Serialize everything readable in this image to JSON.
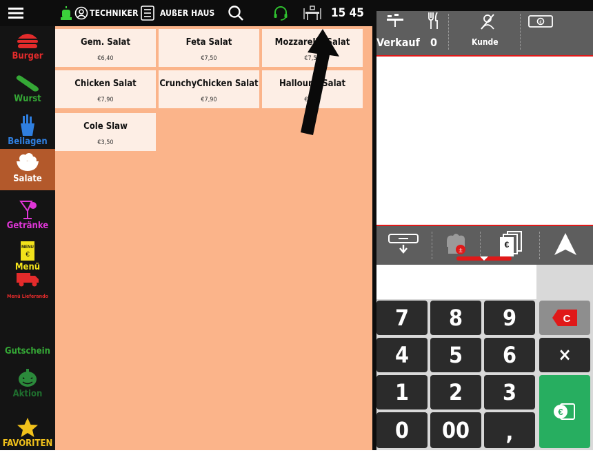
{
  "topbar": {
    "menu_icon": "hamburger-icon",
    "user_label": "TECHNIKER",
    "mode_label": "AUßER HAUS",
    "time": "15 45"
  },
  "categories": [
    {
      "label": "Burger",
      "color": "#e32b2b",
      "icon": "burger-icon"
    },
    {
      "label": "Wurst",
      "color": "#35a836",
      "icon": "sausage-icon"
    },
    {
      "label": "Beilagen",
      "color": "#2f7fe0",
      "icon": "fries-icon"
    },
    {
      "label": "Salate",
      "color": "#ffffff",
      "icon": "salad-bowl-icon",
      "active": true
    },
    {
      "label": "Getränke",
      "color": "#e036d8",
      "icon": "drink-icon"
    },
    {
      "label": "Menü",
      "color": "#f2e21b",
      "icon": "menu-card-icon"
    },
    {
      "label": "Menü Lieferando",
      "color": "#e32b2b",
      "icon": "delivery-truck-icon"
    },
    {
      "label": "Gutschein",
      "color": "#35a836",
      "icon": ""
    },
    {
      "label": "Aktion",
      "color": "#1b6b2b",
      "icon": "pumpkin-icon"
    },
    {
      "label": "FAVORITEN",
      "color": "#f2c21b",
      "icon": "star-icon"
    }
  ],
  "products": [
    {
      "name": "Gem. Salat",
      "price": "€6,40"
    },
    {
      "name": "Feta Salat",
      "price": "€7,50"
    },
    {
      "name": "Mozzarella Salat",
      "price": "€7,50"
    },
    {
      "name": "Chicken Salat",
      "price": "€7,90"
    },
    {
      "name": "CrunchyChicken Salat",
      "price": "€7,90"
    },
    {
      "name": "Halloumi Salat",
      "price": "€7,90"
    },
    {
      "name": "Cole Slaw",
      "price": "€3,50"
    }
  ],
  "order_header": {
    "sale_label": "Verkauf",
    "table_number": "0",
    "customer_label": "Kunde"
  },
  "keypad": {
    "keys": [
      "7",
      "8",
      "9",
      "C",
      "4",
      "5",
      "6",
      "×",
      "1",
      "2",
      "3",
      "0",
      "00",
      ","
    ]
  },
  "colors": {
    "grid_bg": "#fbb48a",
    "tile_bg": "#fdeee5",
    "active_category": "#b3592b",
    "accent_red": "#e01919",
    "pay_green": "#27ae60"
  }
}
